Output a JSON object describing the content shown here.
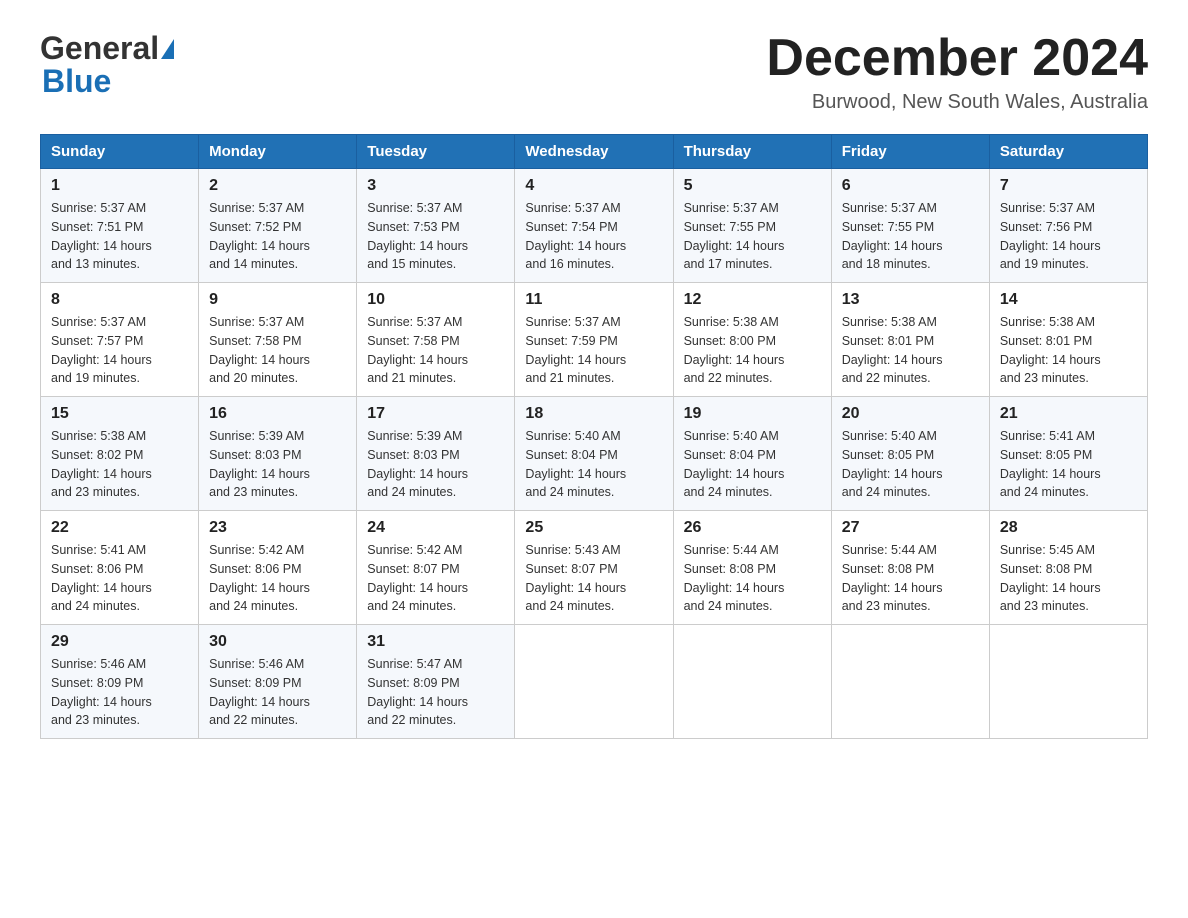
{
  "header": {
    "logo_general": "General",
    "logo_blue": "Blue",
    "month_year": "December 2024",
    "location": "Burwood, New South Wales, Australia"
  },
  "days_of_week": [
    "Sunday",
    "Monday",
    "Tuesday",
    "Wednesday",
    "Thursday",
    "Friday",
    "Saturday"
  ],
  "weeks": [
    [
      {
        "day": "1",
        "sunrise": "5:37 AM",
        "sunset": "7:51 PM",
        "daylight": "14 hours and 13 minutes."
      },
      {
        "day": "2",
        "sunrise": "5:37 AM",
        "sunset": "7:52 PM",
        "daylight": "14 hours and 14 minutes."
      },
      {
        "day": "3",
        "sunrise": "5:37 AM",
        "sunset": "7:53 PM",
        "daylight": "14 hours and 15 minutes."
      },
      {
        "day": "4",
        "sunrise": "5:37 AM",
        "sunset": "7:54 PM",
        "daylight": "14 hours and 16 minutes."
      },
      {
        "day": "5",
        "sunrise": "5:37 AM",
        "sunset": "7:55 PM",
        "daylight": "14 hours and 17 minutes."
      },
      {
        "day": "6",
        "sunrise": "5:37 AM",
        "sunset": "7:55 PM",
        "daylight": "14 hours and 18 minutes."
      },
      {
        "day": "7",
        "sunrise": "5:37 AM",
        "sunset": "7:56 PM",
        "daylight": "14 hours and 19 minutes."
      }
    ],
    [
      {
        "day": "8",
        "sunrise": "5:37 AM",
        "sunset": "7:57 PM",
        "daylight": "14 hours and 19 minutes."
      },
      {
        "day": "9",
        "sunrise": "5:37 AM",
        "sunset": "7:58 PM",
        "daylight": "14 hours and 20 minutes."
      },
      {
        "day": "10",
        "sunrise": "5:37 AM",
        "sunset": "7:58 PM",
        "daylight": "14 hours and 21 minutes."
      },
      {
        "day": "11",
        "sunrise": "5:37 AM",
        "sunset": "7:59 PM",
        "daylight": "14 hours and 21 minutes."
      },
      {
        "day": "12",
        "sunrise": "5:38 AM",
        "sunset": "8:00 PM",
        "daylight": "14 hours and 22 minutes."
      },
      {
        "day": "13",
        "sunrise": "5:38 AM",
        "sunset": "8:01 PM",
        "daylight": "14 hours and 22 minutes."
      },
      {
        "day": "14",
        "sunrise": "5:38 AM",
        "sunset": "8:01 PM",
        "daylight": "14 hours and 23 minutes."
      }
    ],
    [
      {
        "day": "15",
        "sunrise": "5:38 AM",
        "sunset": "8:02 PM",
        "daylight": "14 hours and 23 minutes."
      },
      {
        "day": "16",
        "sunrise": "5:39 AM",
        "sunset": "8:03 PM",
        "daylight": "14 hours and 23 minutes."
      },
      {
        "day": "17",
        "sunrise": "5:39 AM",
        "sunset": "8:03 PM",
        "daylight": "14 hours and 24 minutes."
      },
      {
        "day": "18",
        "sunrise": "5:40 AM",
        "sunset": "8:04 PM",
        "daylight": "14 hours and 24 minutes."
      },
      {
        "day": "19",
        "sunrise": "5:40 AM",
        "sunset": "8:04 PM",
        "daylight": "14 hours and 24 minutes."
      },
      {
        "day": "20",
        "sunrise": "5:40 AM",
        "sunset": "8:05 PM",
        "daylight": "14 hours and 24 minutes."
      },
      {
        "day": "21",
        "sunrise": "5:41 AM",
        "sunset": "8:05 PM",
        "daylight": "14 hours and 24 minutes."
      }
    ],
    [
      {
        "day": "22",
        "sunrise": "5:41 AM",
        "sunset": "8:06 PM",
        "daylight": "14 hours and 24 minutes."
      },
      {
        "day": "23",
        "sunrise": "5:42 AM",
        "sunset": "8:06 PM",
        "daylight": "14 hours and 24 minutes."
      },
      {
        "day": "24",
        "sunrise": "5:42 AM",
        "sunset": "8:07 PM",
        "daylight": "14 hours and 24 minutes."
      },
      {
        "day": "25",
        "sunrise": "5:43 AM",
        "sunset": "8:07 PM",
        "daylight": "14 hours and 24 minutes."
      },
      {
        "day": "26",
        "sunrise": "5:44 AM",
        "sunset": "8:08 PM",
        "daylight": "14 hours and 24 minutes."
      },
      {
        "day": "27",
        "sunrise": "5:44 AM",
        "sunset": "8:08 PM",
        "daylight": "14 hours and 23 minutes."
      },
      {
        "day": "28",
        "sunrise": "5:45 AM",
        "sunset": "8:08 PM",
        "daylight": "14 hours and 23 minutes."
      }
    ],
    [
      {
        "day": "29",
        "sunrise": "5:46 AM",
        "sunset": "8:09 PM",
        "daylight": "14 hours and 23 minutes."
      },
      {
        "day": "30",
        "sunrise": "5:46 AM",
        "sunset": "8:09 PM",
        "daylight": "14 hours and 22 minutes."
      },
      {
        "day": "31",
        "sunrise": "5:47 AM",
        "sunset": "8:09 PM",
        "daylight": "14 hours and 22 minutes."
      },
      null,
      null,
      null,
      null
    ]
  ],
  "labels": {
    "sunrise": "Sunrise:",
    "sunset": "Sunset:",
    "daylight": "Daylight:"
  }
}
